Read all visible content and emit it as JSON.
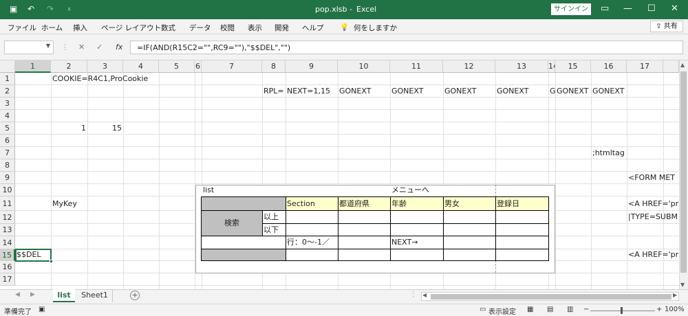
{
  "titlebar": {
    "filename": "pop.xlsb",
    "separator": "-",
    "app": "Excel",
    "signin_label": "サインイン",
    "save_icon": "save-icon",
    "undo_icon": "undo-icon",
    "redo_icon": "redo-icon"
  },
  "ribbon": {
    "tabs": [
      "ファイル",
      "ホーム",
      "挿入",
      "ページ レイアウト",
      "数式",
      "データ",
      "校閲",
      "表示",
      "開発",
      "ヘルプ"
    ],
    "tell_me": "何をしますか",
    "share_label": "共有"
  },
  "formula_bar": {
    "name_box": "",
    "fx_label": "fx",
    "formula": "=IF(AND(R15C2=\"\",RC9=\"\"),\"$$DEL\",\"\")"
  },
  "columns": [
    "1",
    "2",
    "3",
    "4",
    "5",
    "6",
    "7",
    "8",
    "9",
    "10",
    "11",
    "12",
    "13",
    "14",
    "15",
    "16",
    "17"
  ],
  "rows": [
    "1",
    "2",
    "3",
    "4",
    "5",
    "6",
    "7",
    "8",
    "9",
    "10",
    "11",
    "12",
    "13",
    "14",
    "15",
    "16",
    "17"
  ],
  "cells": {
    "r1c2": "COOKIE=R4C1,ProCookie",
    "r2c8": "RPL=",
    "r2c9": "NEXT=1,15",
    "r2c10": "GONEXT",
    "r2c11": "GONEXT",
    "r2c12": "GONEXT",
    "r2c13": "GONEXT",
    "r2c14": "G",
    "r2c15": "GONEXT",
    "r2c16": "GONEXT",
    "r5c2": "1",
    "r5c3": "15",
    "r7c16": ";htmltag",
    "r9c17": "<FORM MET",
    "r10c6": "list",
    "r10c11": "メニューへ",
    "r11c2": "MyKey",
    "r11c9": "Section",
    "r11c10": "都道府県",
    "r11c11": "年齢",
    "r11c12": "男女",
    "r11c13": "登録日",
    "r11c17": "<A HREF='pr",
    "r12c8": "以上",
    "r12c17": "|TYPE=SUBM",
    "r12c6": "検索",
    "r13c8": "以下",
    "r14c9": "行：0～-1／",
    "r14c11": "NEXT→",
    "r15c1": "$$DEL",
    "r15c17": "<A HREF='pr"
  },
  "sheets": {
    "active": "list",
    "other": "Sheet1",
    "add_icon": "plus-icon"
  },
  "status": {
    "ready": "準備完了",
    "display_settings": "表示設定",
    "zoom": "100%",
    "zoom_minus": "−",
    "zoom_plus": "+"
  },
  "colors": {
    "accent": "#217346",
    "header_fill": "#ffffcc",
    "gray_fill": "#c0c0c0"
  }
}
